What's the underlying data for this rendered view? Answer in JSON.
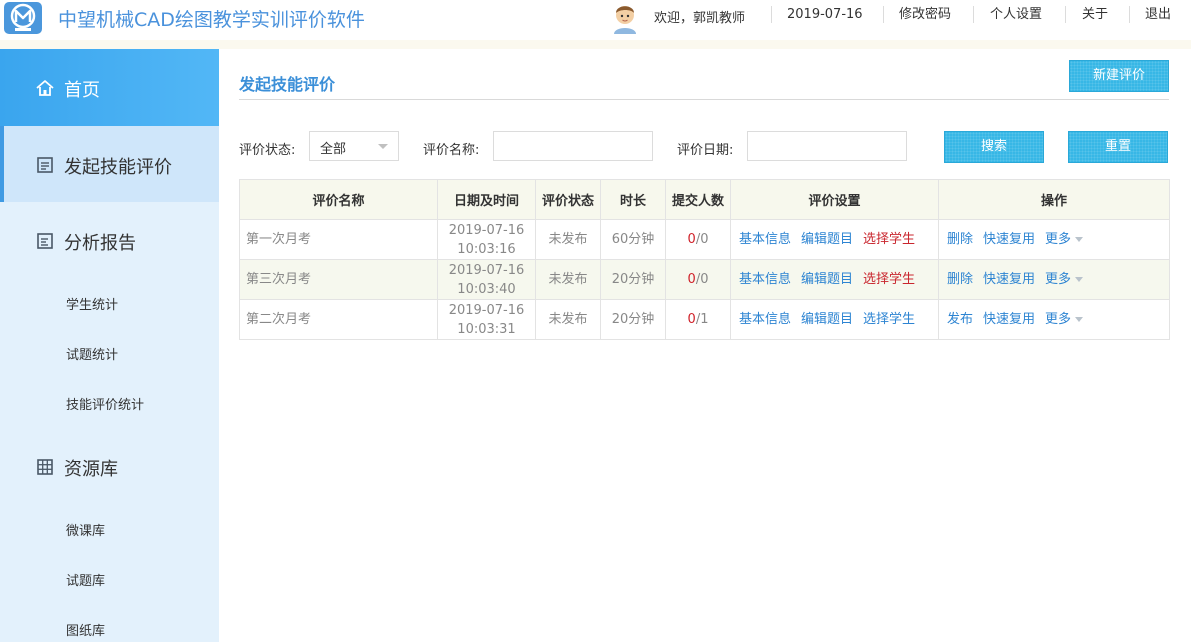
{
  "header": {
    "app_title": "中望机械CAD绘图教学实训评价软件",
    "welcome": "欢迎，郭凯教师",
    "date": "2019-07-16",
    "change_password": "修改密码",
    "personal_settings": "个人设置",
    "about": "关于",
    "logout": "退出"
  },
  "sidebar": {
    "home": "首页",
    "launch_eval": "发起技能评价",
    "analysis": "分析报告",
    "analysis_items": [
      "学生统计",
      "试题统计",
      "技能评价统计"
    ],
    "resources": "资源库",
    "resource_items": [
      "微课库",
      "试题库",
      "图纸库"
    ]
  },
  "main": {
    "title": "发起技能评价",
    "new_button": "新建评价",
    "filters": {
      "status_label": "评价状态:",
      "status_value": "全部",
      "name_label": "评价名称:",
      "date_label": "评价日期:",
      "search_button": "搜索",
      "reset_button": "重置"
    },
    "table": {
      "headers": [
        "评价名称",
        "日期及时间",
        "评价状态",
        "时长",
        "提交人数",
        "评价设置",
        "操作"
      ],
      "rows": [
        {
          "name": "第一次月考",
          "date": "2019-07-16",
          "time": "10:03:16",
          "status": "未发布",
          "duration": "60分钟",
          "submitted": "0",
          "total": "/0",
          "basic": "基本信息",
          "edit": "编辑题目",
          "select": "选择学生",
          "op1": "删除",
          "op2": "快速复用",
          "op3": "更多"
        },
        {
          "name": "第三次月考",
          "date": "2019-07-16",
          "time": "10:03:40",
          "status": "未发布",
          "duration": "20分钟",
          "submitted": "0",
          "total": "/0",
          "basic": "基本信息",
          "edit": "编辑题目",
          "select": "选择学生",
          "op1": "删除",
          "op2": "快速复用",
          "op3": "更多"
        },
        {
          "name": "第二次月考",
          "date": "2019-07-16",
          "time": "10:03:31",
          "status": "未发布",
          "duration": "20分钟",
          "submitted": "0",
          "total": "/1",
          "basic": "基本信息",
          "edit": "编辑题目",
          "select": "选择学生",
          "op1": "发布",
          "op2": "快速复用",
          "op3": "更多"
        }
      ]
    }
  },
  "colors": {
    "accent": "#3b8fd8",
    "sidebar_bg": "#e3f1fc",
    "button": "#37b7e6",
    "danger": "#c9262e"
  }
}
